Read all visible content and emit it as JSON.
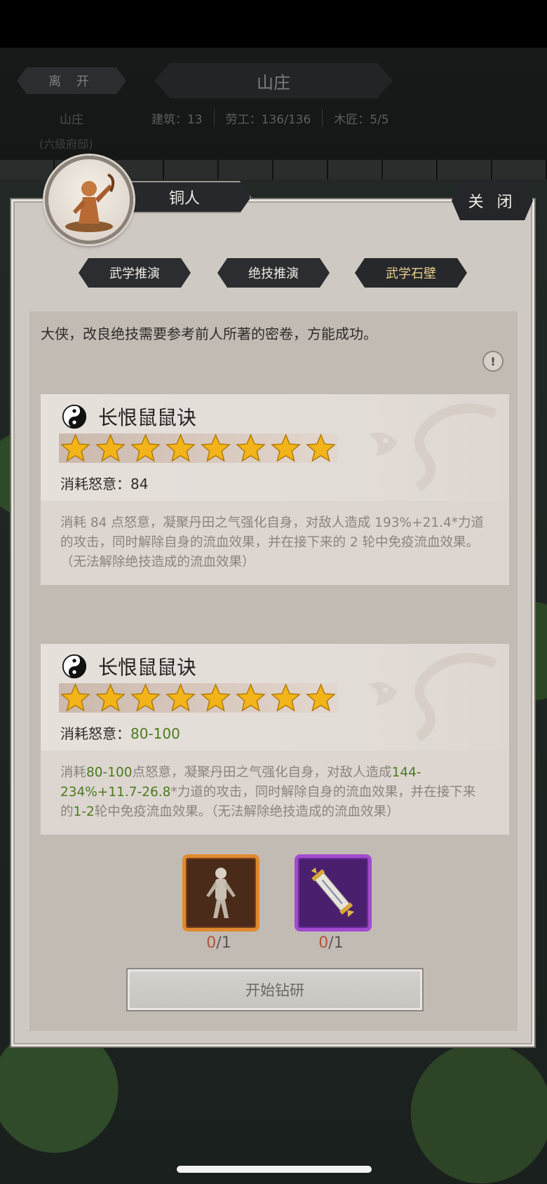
{
  "header": {
    "leave_label": "离 开",
    "estate_title": "山庄",
    "estate_name": "山庄",
    "estate_level": "(六级府邸)",
    "stats": [
      "建筑：13",
      "劳工：136/136",
      "木匠：5/5"
    ]
  },
  "dialog": {
    "character_name": "铜人",
    "close_label": "关 闭",
    "tabs": [
      {
        "label": "武学推演",
        "active": false
      },
      {
        "label": "绝技推演",
        "active": false
      },
      {
        "label": "武学石壁",
        "active": true
      }
    ],
    "notice": "大侠，改良绝技需要参考前人所著的密卷，方能成功。",
    "info_icon": "!"
  },
  "skills": [
    {
      "name": "长恨鼠鼠诀",
      "stars": 8,
      "cost_label": "消耗怒意：",
      "cost_value": "84",
      "desc_parts": [
        "消耗 84 点怒意，凝聚丹田之气强化自身，对敌人造成 193%+21.4*力道的攻击，同时解除自身的流血效果，并在接下来的 2 轮中免疫流血效果。（无法解除绝技造成的流血效果）"
      ]
    },
    {
      "name": "长恨鼠鼠诀",
      "stars": 8,
      "cost_label": "消耗怒意：",
      "cost_value": "80-100",
      "desc_parts": [
        "消耗",
        "80-100",
        "点怒意，凝聚丹田之气强化自身，对敌人造成",
        "144-234%+11.7-26.8",
        "*力道的攻击，同时解除自身的流血效果，并在接下来的",
        "1-2",
        "轮中免疫流血效果。（无法解除绝技造成的流血效果）"
      ]
    }
  ],
  "materials": [
    {
      "icon": "bronze-figure-icon",
      "have": "0",
      "need": "/1",
      "frame_color": "#e08a2e"
    },
    {
      "icon": "scroll-icon",
      "have": "0",
      "need": "/1",
      "frame_color": "#a24ad0"
    }
  ],
  "start_button": "开始钻研",
  "colors": {
    "green": "#4a7a1e",
    "star": "#f2b418",
    "dark_button": "#2b2d30"
  }
}
